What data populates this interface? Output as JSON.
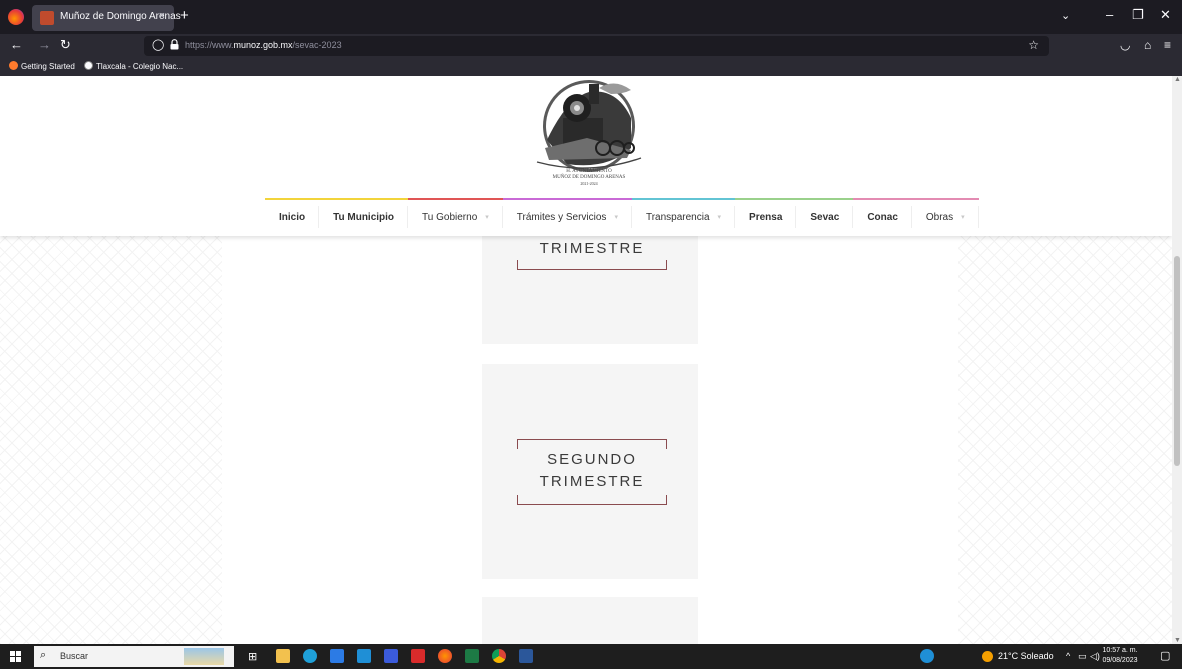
{
  "browser": {
    "tab_title": "Muñoz de Domingo Arenas",
    "tab_close": "×",
    "new_tab": "+",
    "url_domain_prefix": "https://www.",
    "url_domain": "munoz.gob.mx",
    "url_path": "/sevac-2023",
    "bookmarks": [
      {
        "label": "Getting Started"
      },
      {
        "label": "Tlaxcala - Colegio Nac..."
      }
    ]
  },
  "site": {
    "logo_text": [
      "H. AYUNTAMIENTO",
      "MUÑOZ DE DOMINGO ARENAS",
      "2021-2024"
    ],
    "menu": [
      {
        "label": "Inicio",
        "color": "#f2d43b",
        "caret": false
      },
      {
        "label": "Tu Municipio",
        "color": "#f2d43b",
        "caret": false
      },
      {
        "label": "Tu Gobierno",
        "color": "#e05555",
        "caret": true
      },
      {
        "label": "Trámites y Servicios",
        "color": "#c96ad6",
        "caret": true
      },
      {
        "label": "Transparencia",
        "color": "#62c4d4",
        "caret": true
      },
      {
        "label": "Prensa",
        "color": "#9ad18b",
        "caret": false
      },
      {
        "label": "Sevac",
        "color": "#9ad18b",
        "caret": false
      },
      {
        "label": "Conac",
        "color": "#e38bb2",
        "caret": false
      },
      {
        "label": "Obras",
        "color": "#e38bb2",
        "caret": true
      }
    ],
    "cards": [
      {
        "lines": [
          "TRIMESTRE"
        ]
      },
      {
        "lines": [
          "SEGUNDO",
          "TRIMESTRE"
        ]
      }
    ],
    "accent_color": "#8a4b4f"
  },
  "taskbar": {
    "search_placeholder": "Buscar",
    "weather": "21°C  Soleado",
    "time": "10:57 a. m.",
    "date": "09/08/2023"
  }
}
